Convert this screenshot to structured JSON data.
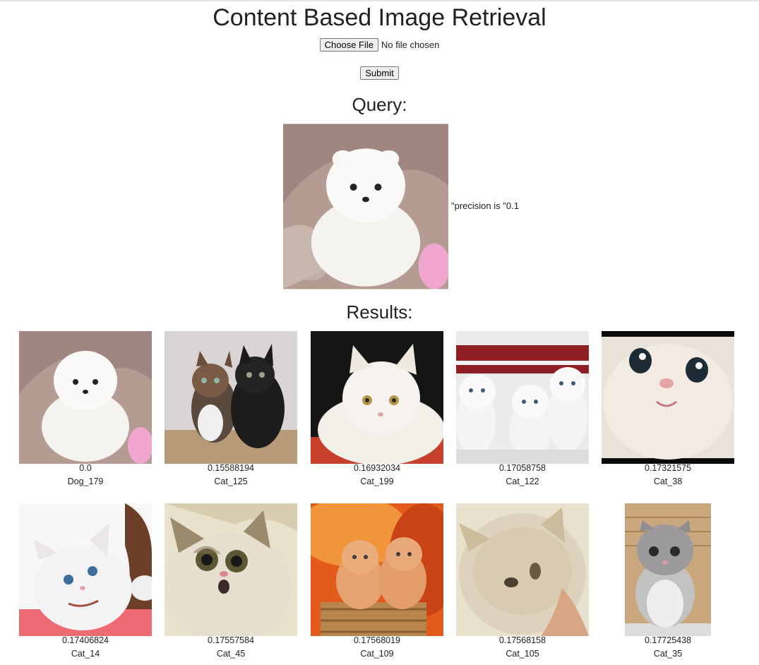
{
  "page": {
    "title": "Content Based Image Retrieval"
  },
  "upload": {
    "choose_label": "Choose File",
    "status": "No file chosen",
    "submit_label": "Submit"
  },
  "query": {
    "heading": "Query:",
    "precision_text": "\"precision is \"0.1"
  },
  "results": {
    "heading": "Results:",
    "items": [
      {
        "distance": "0.0",
        "label": "Dog_179"
      },
      {
        "distance": "0.15588194",
        "label": "Cat_125"
      },
      {
        "distance": "0.16932034",
        "label": "Cat_199"
      },
      {
        "distance": "0.17058758",
        "label": "Cat_122"
      },
      {
        "distance": "0.17321575",
        "label": "Cat_38"
      },
      {
        "distance": "0.17406824",
        "label": "Cat_14"
      },
      {
        "distance": "0.17557584",
        "label": "Cat_45"
      },
      {
        "distance": "0.17568019",
        "label": "Cat_109"
      },
      {
        "distance": "0.17568158",
        "label": "Cat_105"
      },
      {
        "distance": "0.17725438",
        "label": "Cat_35"
      }
    ]
  }
}
